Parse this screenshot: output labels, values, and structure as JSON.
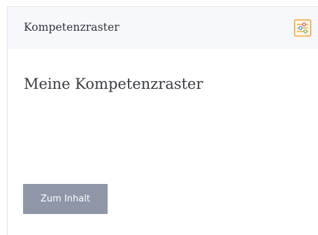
{
  "panel": {
    "title": "Kompetenzraster",
    "settings_icon": "sliders-icon"
  },
  "main": {
    "heading": "Meine Kompetenzraster",
    "content_button_label": "Zum Inhalt"
  },
  "colors": {
    "icon_accent": "#f2a33a",
    "icon_red": "#e0525c",
    "icon_blue": "#4a90c8",
    "icon_green": "#7ab55c",
    "button_bg": "#8e96a8",
    "header_bg": "#f6f8fb"
  }
}
